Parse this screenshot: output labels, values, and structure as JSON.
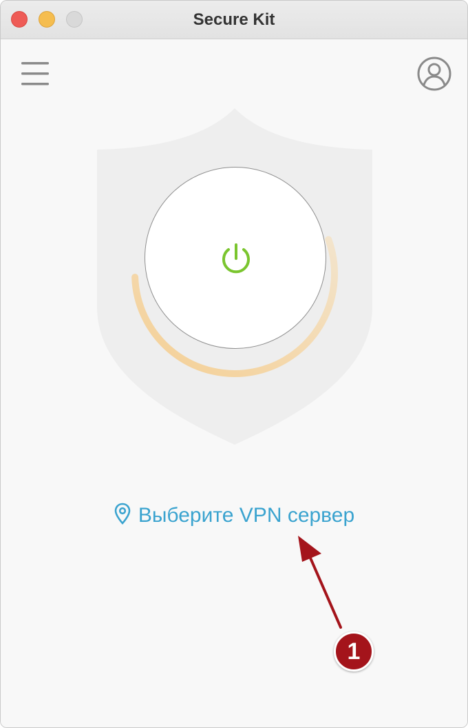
{
  "window": {
    "title": "Secure Kit"
  },
  "header": {
    "menu_icon": "hamburger-menu-icon",
    "account_icon": "user-account-icon"
  },
  "connection": {
    "power_icon": "power-icon",
    "status_color": "#7ac52e",
    "progress_fraction": 0.55
  },
  "server": {
    "label": "Выберите VPN сервер",
    "icon": "location-pin-icon",
    "color": "#3aa3cf"
  },
  "annotation": {
    "badge_label": "1",
    "color": "#a4141b"
  }
}
